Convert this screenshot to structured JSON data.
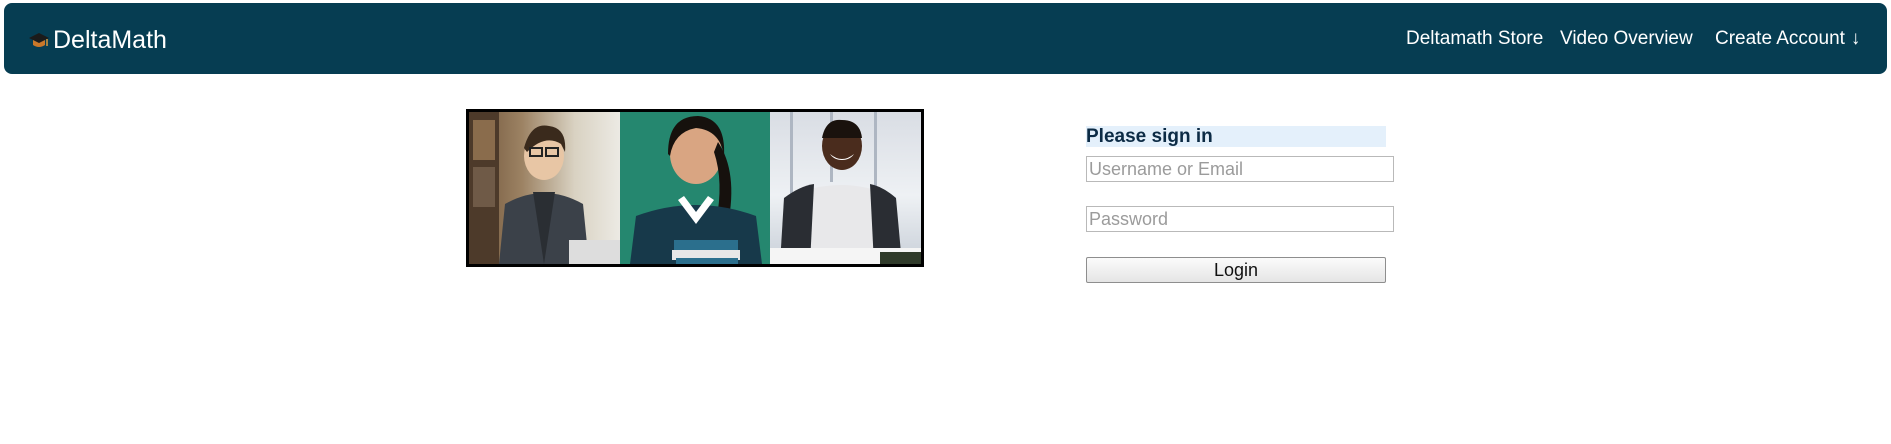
{
  "navbar": {
    "brand": "DeltaMath",
    "brand_icon": "graduation-cap-icon",
    "bg_color": "#063d52",
    "links": {
      "store": "Deltamath Store",
      "video": "Video Overview",
      "create": "Create Account",
      "create_arrow": "↓"
    }
  },
  "signin": {
    "title": "Please sign in",
    "username_placeholder": "Username or Email",
    "password_placeholder": "Password",
    "login_label": "Login"
  }
}
